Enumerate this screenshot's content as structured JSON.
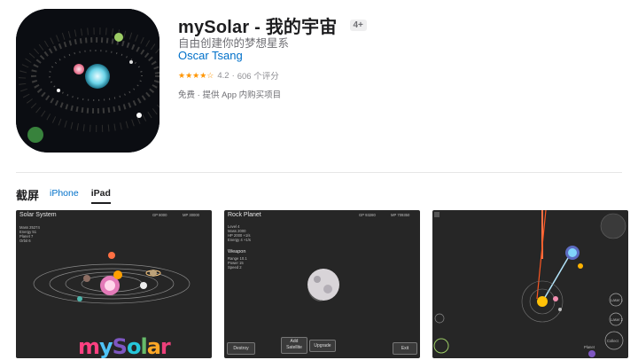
{
  "app": {
    "title": "mySolar - 我的宇宙",
    "age_rating": "4+",
    "subtitle": "自由创建你的梦想星系",
    "developer": "Oscar Tsang",
    "rating_value": "4.2",
    "rating_count": "606 个评分",
    "price_note": "免费 · 提供 App 内购买项目",
    "rating_stars": 4.2
  },
  "screenshots": {
    "section_title": "截屏",
    "tabs": [
      {
        "label": "iPhone",
        "active": false
      },
      {
        "label": "iPad",
        "active": true
      }
    ],
    "shot1": {
      "title": "Solar System",
      "gp": "GP  8000",
      "mp": "MP  30000",
      "stats": [
        "Mass   25274",
        "Energy  51",
        "Planet   7",
        "Orbit    6"
      ],
      "logo": "mySolar"
    },
    "shot2": {
      "title": "Rock Planet",
      "gp": "GP  93280",
      "mp": "MP  709350",
      "stats": [
        "Level    4",
        "Mass    2000",
        "HP       2000   +1/s",
        "Energy  4       +1/s"
      ],
      "weapon_title": "Weapon",
      "weapon_stats": [
        "Range   10.1",
        "Power    15",
        "Speed    2"
      ],
      "buttons": {
        "destroy": "Destroy",
        "add_satellite": "Add Satellite",
        "upgrade": "Upgrade",
        "exit": "Exit"
      }
    },
    "shot3": {
      "labels": {
        "laser1": "Laser 1",
        "laser2": "Laser 2",
        "collect": "Collect",
        "planet": "Planet"
      }
    }
  },
  "colors": {
    "link": "#0070c9",
    "star": "#ff9500",
    "text": "#1d1d1f",
    "secondary": "#6e6e73"
  }
}
